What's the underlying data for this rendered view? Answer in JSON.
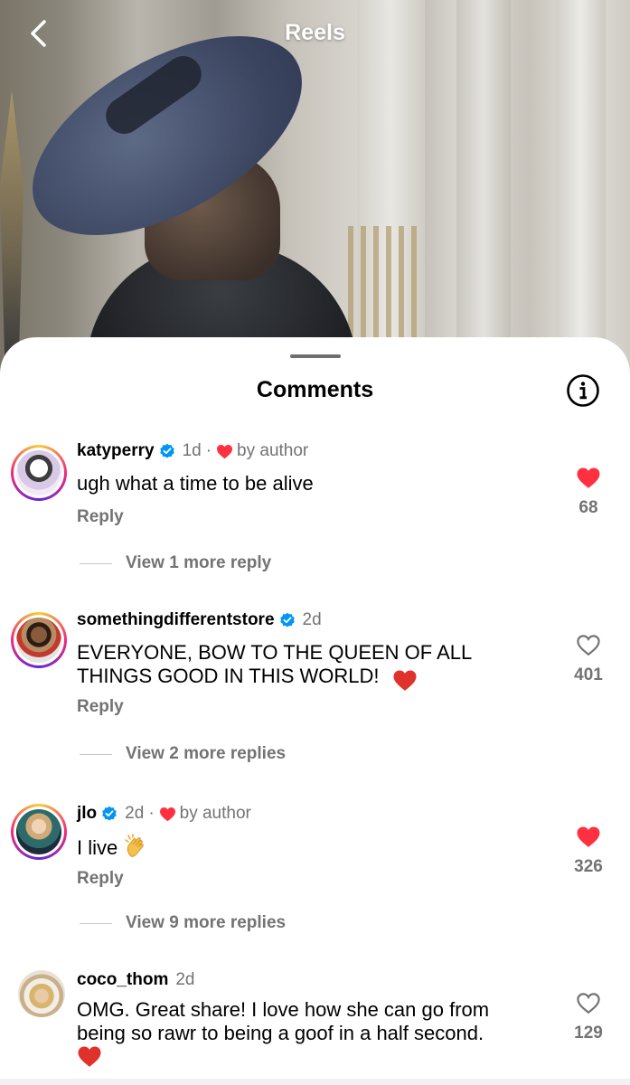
{
  "topbar": {
    "title": "Reels",
    "back_icon": "chevron-left-icon"
  },
  "sheet": {
    "title": "Comments",
    "info_icon": "info-circle-icon"
  },
  "colors": {
    "like_red": "#ff3040",
    "verified_blue": "#0095f6",
    "secondary_text": "#737373"
  },
  "comments": [
    {
      "username": "katyperry",
      "verified": true,
      "time": "1d",
      "liked_by_author": true,
      "liked_by_author_label": "by author",
      "text": "ugh what a time to be alive",
      "reply_label": "Reply",
      "liked": true,
      "like_count": "68",
      "view_more_label": "View 1 more reply"
    },
    {
      "username": "somethingdifferentstore",
      "verified": true,
      "time": "2d",
      "liked_by_author": false,
      "text_line1": "EVERYONE, BOW TO THE QUEEN OF ALL",
      "text_line2": "THINGS GOOD IN THIS WORLD!",
      "reply_label": "Reply",
      "liked": false,
      "like_count": "401",
      "view_more_label": "View 2 more replies"
    },
    {
      "username": "jlo",
      "verified": true,
      "time": "2d",
      "liked_by_author": true,
      "liked_by_author_label": "by author",
      "text": "I live",
      "reply_label": "Reply",
      "liked": true,
      "like_count": "326",
      "view_more_label": "View 9 more replies"
    },
    {
      "username": "coco_thom",
      "verified": false,
      "time": "2d",
      "text_line1": "OMG. Great share! I love how she can go from",
      "text_line2": "being so rawr to being a goof in a half second.",
      "liked": false,
      "like_count": "129"
    }
  ]
}
